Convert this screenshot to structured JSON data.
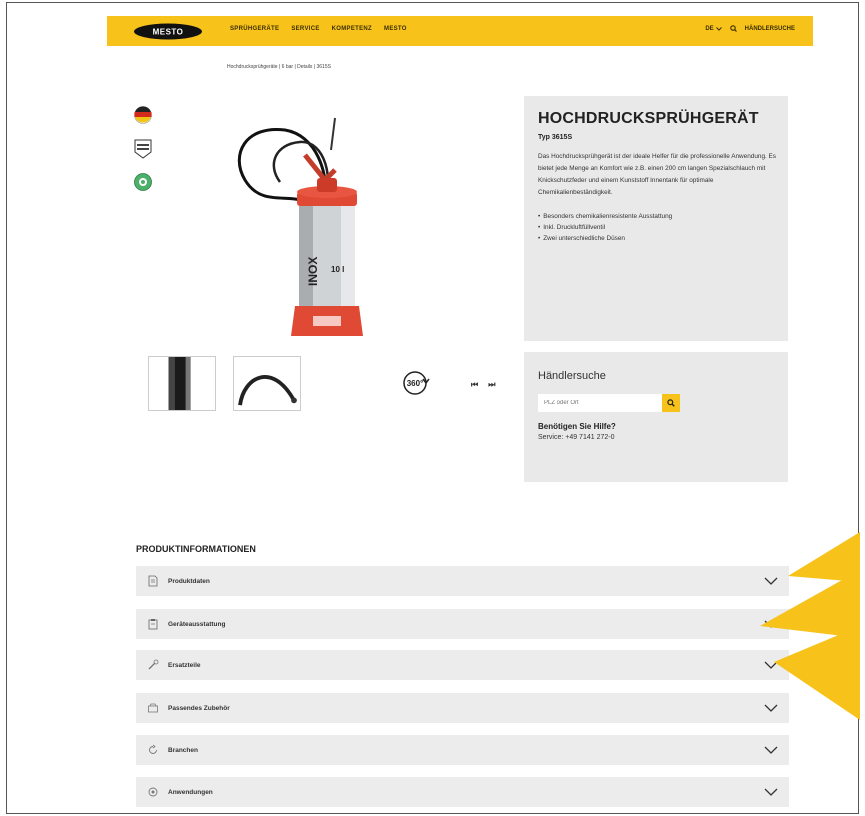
{
  "brand": {
    "logo_text": "MESTO",
    "accent": "#f7c21a"
  },
  "nav": {
    "items": [
      "SPRÜHGERÄTE",
      "SERVICE",
      "KOMPETENZ",
      "MESTO"
    ]
  },
  "header_right": {
    "language": "DE",
    "dealer_search_label": "HÄNDLERSUCHE",
    "icons": [
      "chevron-down-icon",
      "search-icon"
    ]
  },
  "breadcrumb": {
    "text": "Hochdrucksprühgeräte | 6 bar | Details | 3615S"
  },
  "badges": [
    "germany-flag-icon",
    "made-in-germany-icon",
    "round-badge-icon"
  ],
  "product": {
    "title": "HOCHDRUCKSPRÜHGERÄT",
    "type": "Typ 3615S",
    "description": "Das Hochdrucksprühgerät ist der ideale Helfer für die professionelle Anwendung. Es bietet jede Menge an Komfort wie z.B. einen 200 cm langen Spezialschlauch mit Knickschutzfeder und einem Kunststoff Innentank für optimale Chemikalienbeständigkeit.",
    "features": [
      "Besonders chemikalienresistente Ausstattung",
      "Inkl. Druckluftfüllventil",
      "Zwei unterschiedliche Düsen"
    ],
    "image_label": "10 l",
    "image_text": "INOX"
  },
  "viewer": {
    "rotate_label": "360°",
    "prev_icon": "skip-back-icon",
    "next_icon": "skip-forward-icon"
  },
  "dealer": {
    "title": "Händlersuche",
    "input_placeholder": "PLZ oder Ort",
    "help_title": "Benötigen Sie Hilfe?",
    "service_text": "Service: +49 7141 272-0"
  },
  "product_info": {
    "heading": "PRODUKTINFORMATIONEN",
    "sections": [
      {
        "label": "Produktdaten",
        "icon": "document-icon"
      },
      {
        "label": "Geräteausstattung",
        "icon": "clipboard-icon"
      },
      {
        "label": "Ersatzteile",
        "icon": "wrench-icon"
      },
      {
        "label": "Passendes Zubehör",
        "icon": "box-icon"
      },
      {
        "label": "Branchen",
        "icon": "refresh-icon"
      },
      {
        "label": "Anwendungen",
        "icon": "gear-icon"
      }
    ]
  }
}
